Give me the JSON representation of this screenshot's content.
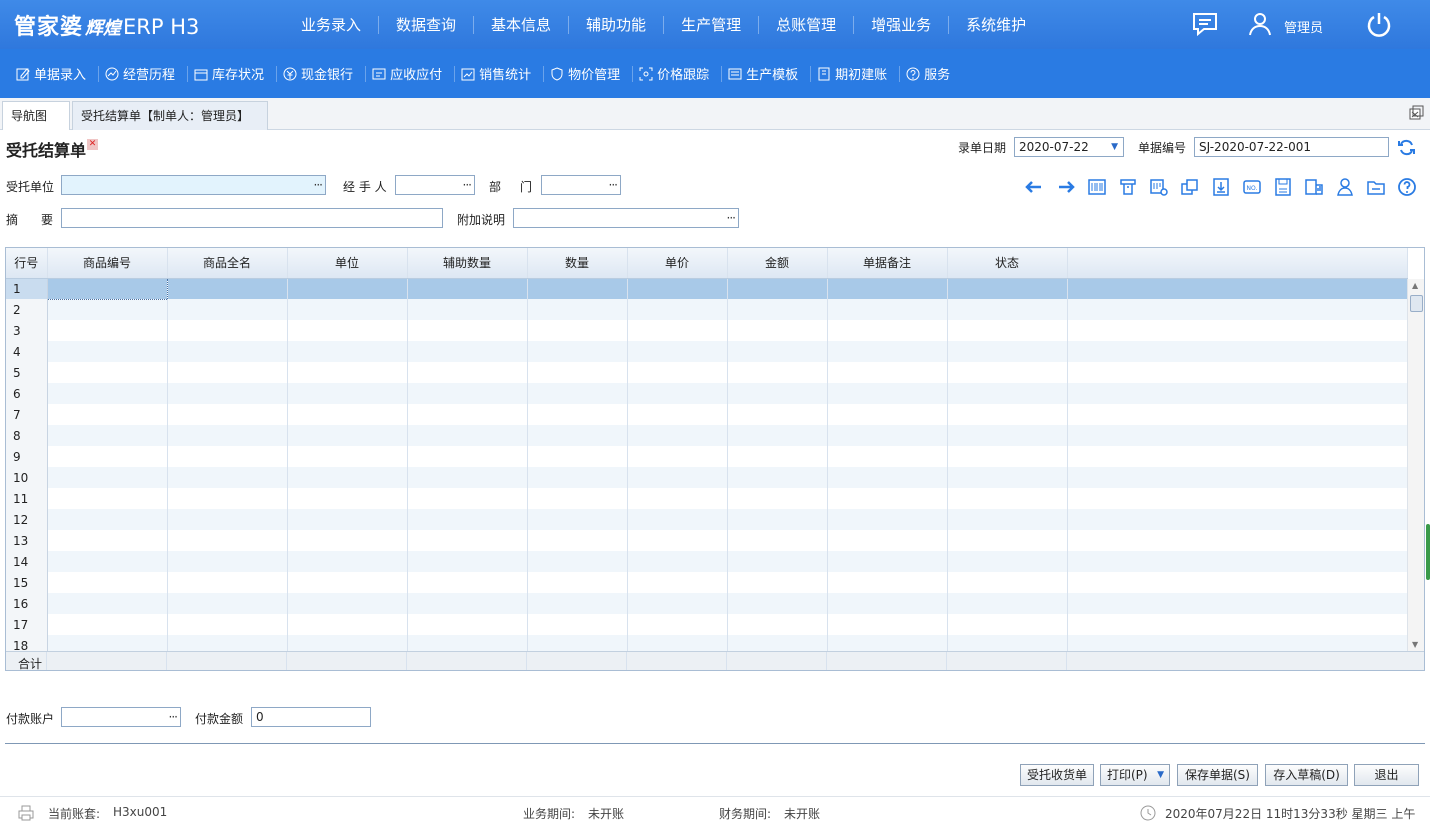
{
  "app": {
    "logo_main": "管家婆",
    "logo_sub": "辉煌",
    "logo_product": "ERP H3",
    "user": "管理员"
  },
  "main_menu": [
    "业务录入",
    "数据查询",
    "基本信息",
    "辅助功能",
    "生产管理",
    "总账管理",
    "增强业务",
    "系统维护"
  ],
  "sub_menu": [
    {
      "label": "单据录入",
      "icon": "edit-icon"
    },
    {
      "label": "经营历程",
      "icon": "trend-icon"
    },
    {
      "label": "库存状况",
      "icon": "box-icon"
    },
    {
      "label": "现金银行",
      "icon": "yuan-icon"
    },
    {
      "label": "应收应付",
      "icon": "ledger-icon"
    },
    {
      "label": "销售统计",
      "icon": "sales-icon"
    },
    {
      "label": "物价管理",
      "icon": "shield-icon"
    },
    {
      "label": "价格跟踪",
      "icon": "track-icon"
    },
    {
      "label": "生产模板",
      "icon": "template-icon"
    },
    {
      "label": "期初建账",
      "icon": "book-icon"
    },
    {
      "label": "服务",
      "icon": "help-circle-icon"
    }
  ],
  "tabs": {
    "nav": "导航图",
    "active": "受托结算单【制单人：管理员】"
  },
  "form": {
    "title": "受托结算单",
    "date_label": "录单日期",
    "date_value": "2020-07-22",
    "number_label": "单据编号",
    "number_value": "SJ-2020-07-22-001",
    "unit_label": "受托单位",
    "handler_label": "经 手 人",
    "dept_label_a": "部",
    "dept_label_b": "门",
    "summary_label_a": "摘",
    "summary_label_b": "要",
    "note_label": "附加说明",
    "dots": "···"
  },
  "grid": {
    "columns": [
      "行号",
      "商品编号",
      "商品全名",
      "单位",
      "辅助数量",
      "数量",
      "单价",
      "金额",
      "单据备注",
      "状态"
    ],
    "rows": [
      "1",
      "2",
      "3",
      "4",
      "5",
      "6",
      "7",
      "8",
      "9",
      "10",
      "11",
      "12",
      "13",
      "14",
      "15",
      "16",
      "17",
      "18"
    ],
    "total_label": "合计"
  },
  "payment": {
    "account_label": "付款账户",
    "amount_label": "付款金额",
    "amount_value": "0"
  },
  "buttons": {
    "receipt": "受托收货单",
    "print": "打印(P)",
    "save": "保存单据(S)",
    "draft": "存入草稿(D)",
    "exit": "退出"
  },
  "status": {
    "account_label": "当前账套:",
    "account_value": "H3xu001",
    "biz_period_label": "业务期间:",
    "biz_period_value": "未开账",
    "fin_period_label": "财务期间:",
    "fin_period_value": "未开账",
    "datetime": "2020年07月22日 11时13分33秒 星期三 上午"
  },
  "colors": {
    "topbar": "#3f8ae8",
    "subbar": "#2a7be3",
    "selected_row": "#a8c9e8"
  }
}
